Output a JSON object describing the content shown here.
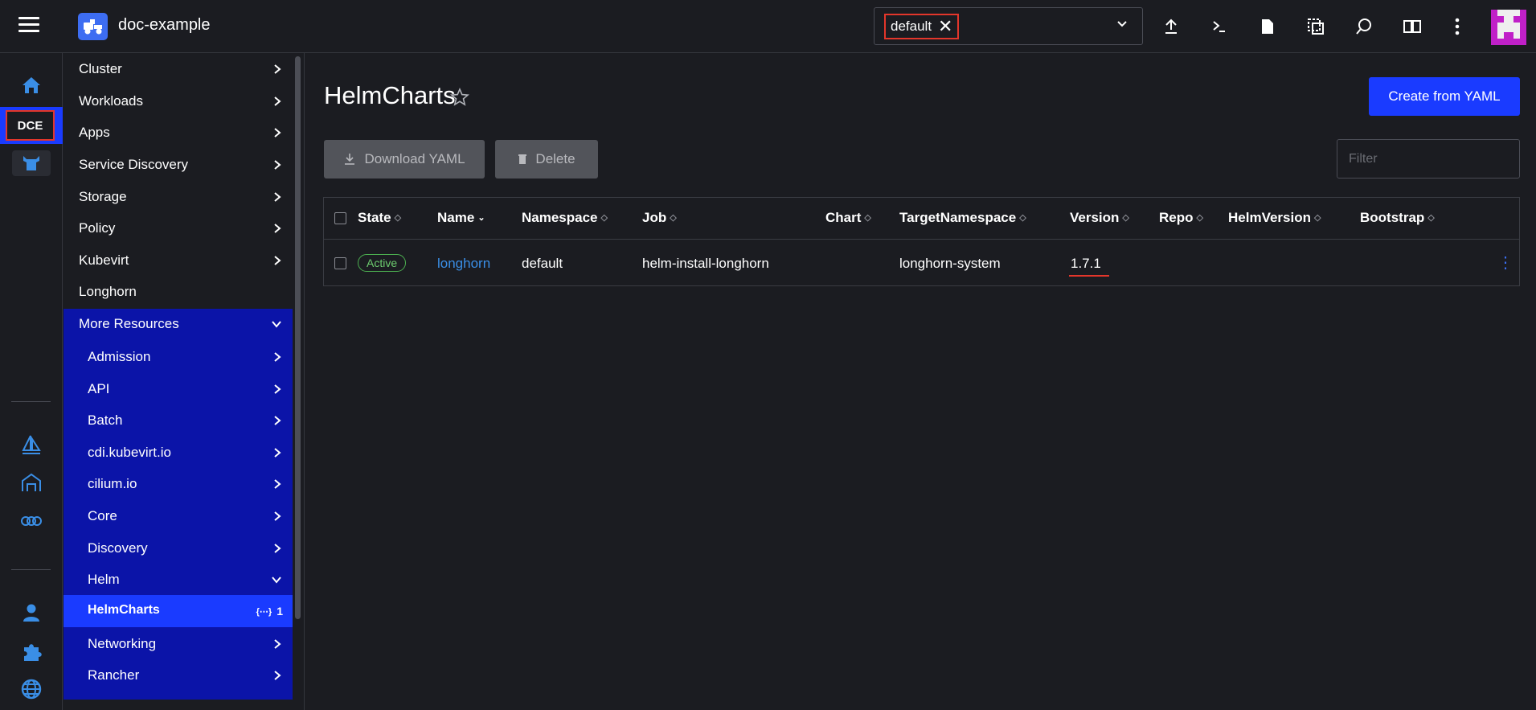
{
  "header": {
    "cluster_name": "doc-example",
    "namespace_chip": "default",
    "icons": [
      "upload-icon",
      "terminal-icon",
      "file-icon",
      "copy-icon",
      "search-icon",
      "book-icon",
      "more-vert-icon"
    ]
  },
  "rail": {
    "dce_label": "DCE"
  },
  "sidenav": {
    "items": [
      {
        "label": "Cluster"
      },
      {
        "label": "Workloads"
      },
      {
        "label": "Apps"
      },
      {
        "label": "Service Discovery"
      },
      {
        "label": "Storage"
      },
      {
        "label": "Policy"
      },
      {
        "label": "Kubevirt"
      },
      {
        "label": "Longhorn"
      }
    ],
    "more_resources": "More Resources",
    "sub_items": [
      {
        "label": "Admission"
      },
      {
        "label": "API"
      },
      {
        "label": "Batch"
      },
      {
        "label": "cdi.kubevirt.io"
      },
      {
        "label": "cilium.io"
      },
      {
        "label": "Core"
      },
      {
        "label": "Discovery"
      },
      {
        "label": "Helm"
      }
    ],
    "active_item": {
      "label": "HelmCharts",
      "count": "1"
    },
    "after_items": [
      {
        "label": "Networking"
      },
      {
        "label": "Rancher"
      }
    ]
  },
  "main": {
    "title": "HelmCharts",
    "create_button": "Create from YAML",
    "download_button": "Download YAML",
    "delete_button": "Delete",
    "filter_placeholder": "Filter",
    "columns": [
      "State",
      "Name",
      "Namespace",
      "Job",
      "Chart",
      "TargetNamespace",
      "Version",
      "Repo",
      "HelmVersion",
      "Bootstrap"
    ],
    "rows": [
      {
        "state": "Active",
        "name": "longhorn",
        "namespace": "default",
        "job": "helm-install-longhorn",
        "chart": "",
        "target_namespace": "longhorn-system",
        "version": "1.7.1",
        "repo": "",
        "helm_version": "",
        "bootstrap": ""
      }
    ]
  },
  "colors": {
    "accent": "#1a3bff",
    "nav_group_bg": "#0b14a8",
    "highlight_border": "#e3362b",
    "link": "#3a8ee6",
    "active_status": "#4caf50"
  }
}
